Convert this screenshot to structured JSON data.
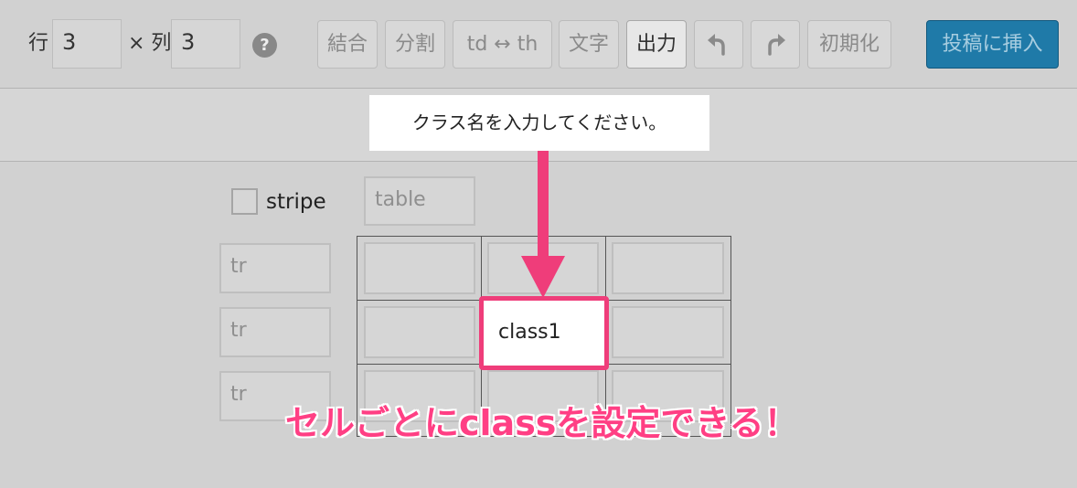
{
  "toolbar": {
    "rows_label": "行",
    "rows_value": "3",
    "cols_label": "× 列",
    "cols_value": "3",
    "help_icon": "?",
    "buttons": {
      "merge": "結合",
      "split": "分割",
      "td_th": "td ↔ th",
      "text": "文字",
      "output": "出力",
      "undo_icon": "undo-arrow",
      "redo_icon": "redo-arrow",
      "reset": "初期化"
    },
    "insert": "投稿に挿入"
  },
  "tooltip": "クラス名を入力してください。",
  "table_options": {
    "stripe_label": "stripe",
    "table_placeholder": "table",
    "tr_placeholders": [
      "tr",
      "tr",
      "tr"
    ]
  },
  "cells": {
    "highlighted_value": "class1"
  },
  "caption": "セルごとにclassを設定できる！",
  "colors": {
    "accent": "#ef3d7a",
    "insert_button": "#1f7aa8"
  }
}
